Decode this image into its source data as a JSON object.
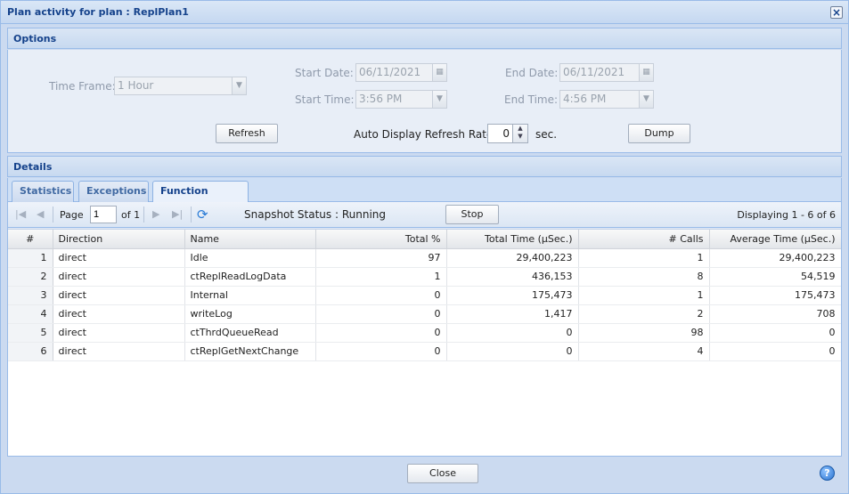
{
  "window": {
    "title": "Plan activity for plan : ReplPlan1"
  },
  "options": {
    "header": "Options",
    "time_frame_label": "Time Frame:",
    "time_frame_value": "1 Hour",
    "start_date_label": "Start Date:",
    "start_date_value": "06/11/2021",
    "end_date_label": "End Date:",
    "end_date_value": "06/11/2021",
    "start_time_label": "Start Time:",
    "start_time_value": "3:56 PM",
    "end_time_label": "End Time:",
    "end_time_value": "4:56 PM",
    "refresh_label": "Refresh",
    "auto_refresh_label": "Auto Display Refresh Rate:",
    "auto_refresh_value": "0",
    "auto_refresh_unit": "sec.",
    "dump_label": "Dump"
  },
  "details": {
    "header": "Details",
    "tabs": [
      {
        "label": "Statistics",
        "active": false
      },
      {
        "label": "Exceptions",
        "active": false
      },
      {
        "label": "Function Timing",
        "active": true
      }
    ],
    "toolbar": {
      "page_label": "Page",
      "page_value": "1",
      "of_label": "of 1",
      "snapshot_status": "Snapshot Status : Running",
      "stop_label": "Stop",
      "displaying": "Displaying 1 - 6 of 6"
    },
    "grid": {
      "columns": [
        "#",
        "Direction",
        "Name",
        "Total %",
        "Total Time (µSec.)",
        "# Calls",
        "Average Time (µSec.)"
      ],
      "rows": [
        [
          "1",
          "direct",
          "Idle",
          "97",
          "29,400,223",
          "1",
          "29,400,223"
        ],
        [
          "2",
          "direct",
          "ctReplReadLogData",
          "1",
          "436,153",
          "8",
          "54,519"
        ],
        [
          "3",
          "direct",
          "Internal",
          "0",
          "175,473",
          "1",
          "175,473"
        ],
        [
          "4",
          "direct",
          "writeLog",
          "0",
          "1,417",
          "2",
          "708"
        ],
        [
          "5",
          "direct",
          "ctThrdQueueRead",
          "0",
          "0",
          "98",
          "0"
        ],
        [
          "6",
          "direct",
          "ctReplGetNextChange",
          "0",
          "0",
          "4",
          "0"
        ]
      ]
    }
  },
  "footer": {
    "close_label": "Close",
    "help_icon": "?"
  }
}
